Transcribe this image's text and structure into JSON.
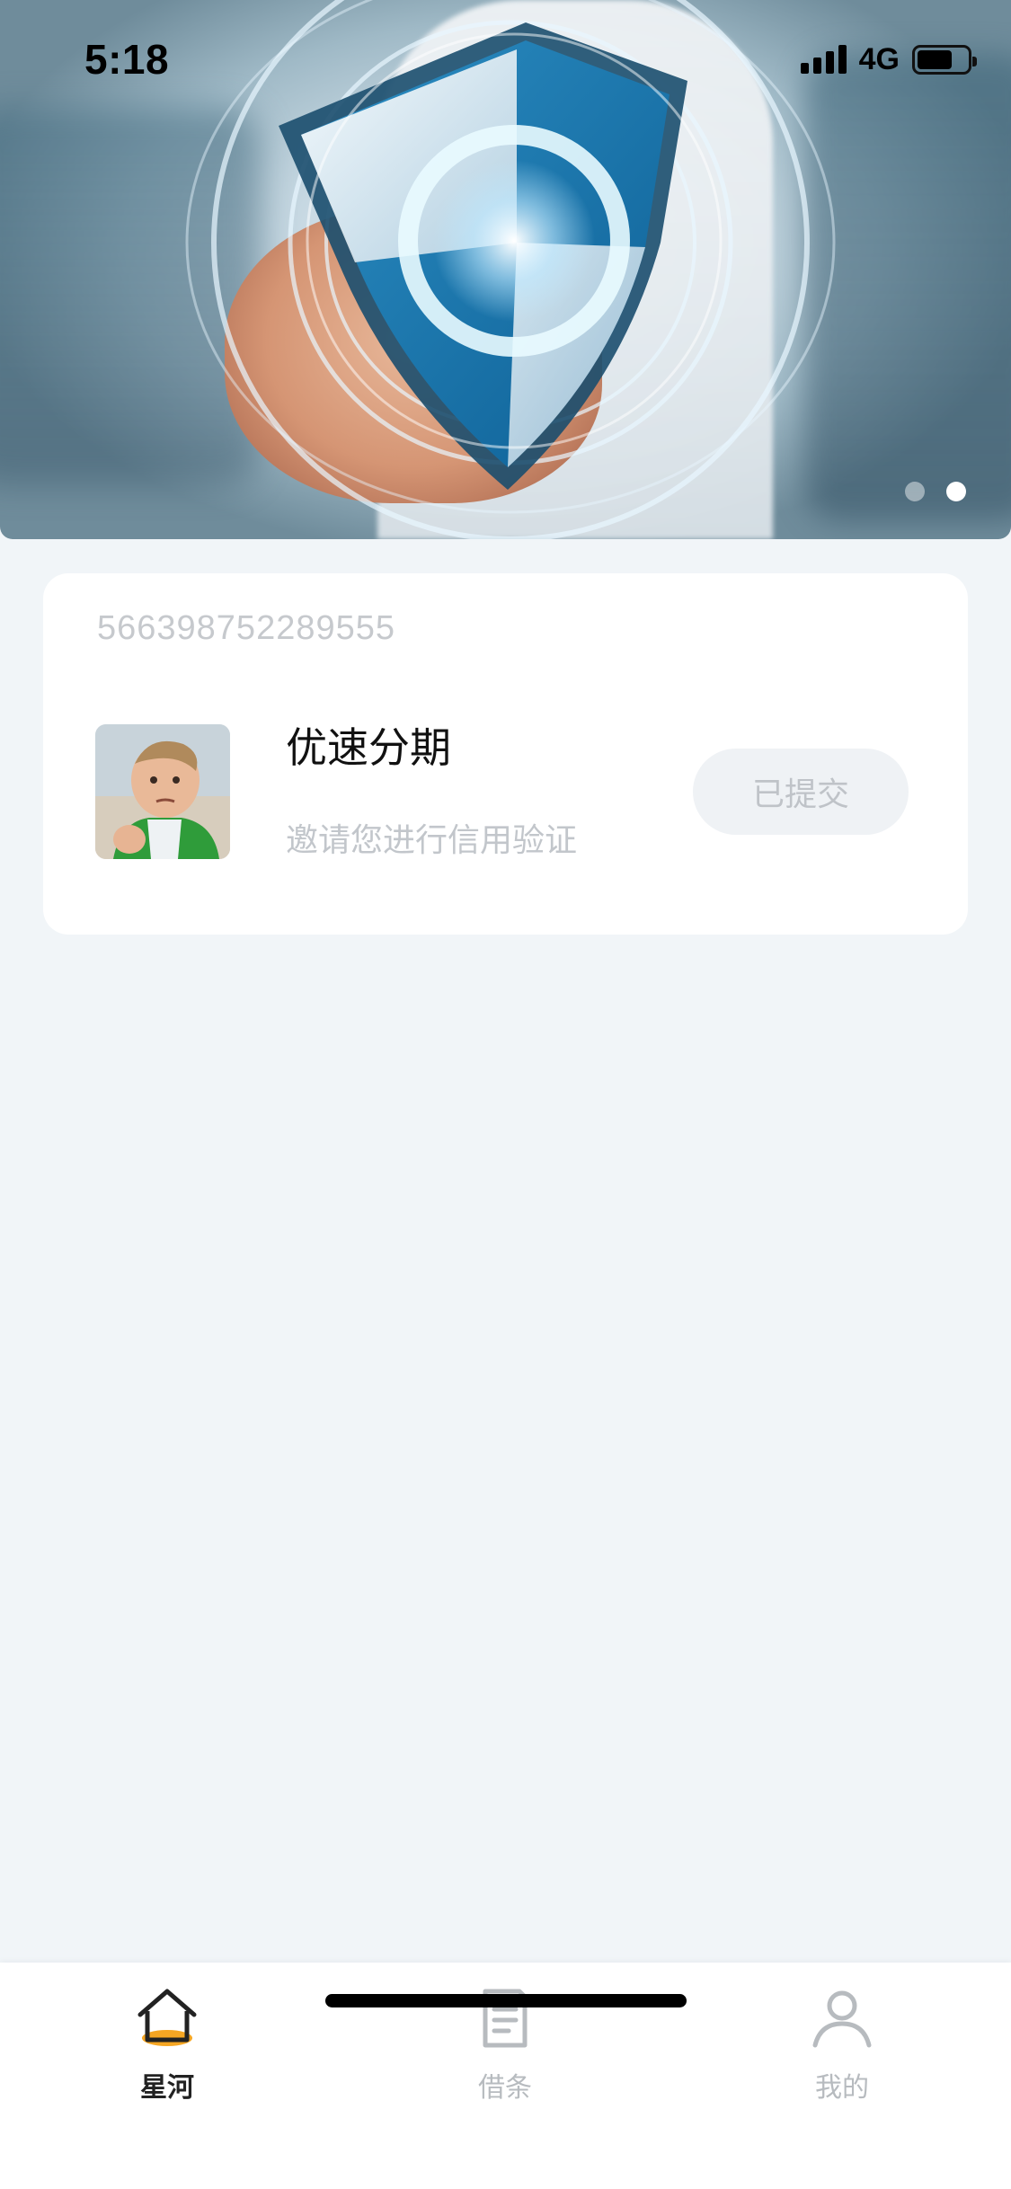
{
  "status_bar": {
    "time": "5:18",
    "network": "4G",
    "battery_level_fraction": 0.7
  },
  "banner": {
    "slide_count": 2,
    "active_slide": 2
  },
  "card": {
    "id_number": "566398752289555",
    "title": "优速分期",
    "subtitle": "邀请您进行信用验证",
    "button_label": "已提交"
  },
  "tabbar": {
    "items": [
      {
        "label": "星河",
        "icon": "home-icon",
        "active": true
      },
      {
        "label": "借条",
        "icon": "document-icon",
        "active": false
      },
      {
        "label": "我的",
        "icon": "user-icon",
        "active": false
      }
    ]
  },
  "colors": {
    "page_background": "#f1f5f8",
    "accent": "#f5a623",
    "button_background": "#eff2f5",
    "muted_text": "#c2c6cb"
  }
}
